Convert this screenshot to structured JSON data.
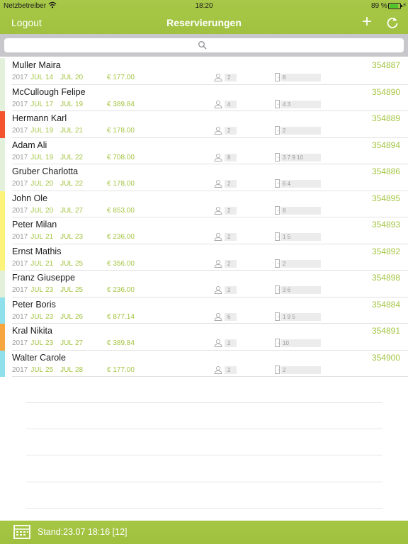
{
  "status": {
    "carrier": "Netzbetreiber",
    "time": "18:20",
    "battery": "89 %"
  },
  "nav": {
    "logout": "Logout",
    "title": "Reservierungen"
  },
  "search": {
    "placeholder": ""
  },
  "reservations": [
    {
      "name": "Muller Maira",
      "number": "354887",
      "year": "2017",
      "from_month": "JUL",
      "from_day": "14",
      "to_month": "JUL",
      "to_day": "20",
      "price": "€ 177.00",
      "guests": "2",
      "rooms": "8",
      "color": "#e3f0dc"
    },
    {
      "name": "McCullough Felipe",
      "number": "354890",
      "year": "2017",
      "from_month": "JUL",
      "from_day": "17",
      "to_month": "JUL",
      "to_day": "19",
      "price": "€ 389.84",
      "guests": "4",
      "rooms": "4 3",
      "color": "#e3f0dc"
    },
    {
      "name": "Hermann Karl",
      "number": "354889",
      "year": "2017",
      "from_month": "JUL",
      "from_day": "19",
      "to_month": "JUL",
      "to_day": "21",
      "price": "€ 178.00",
      "guests": "2",
      "rooms": "2",
      "color": "#f5532f"
    },
    {
      "name": "Adam Ali",
      "number": "354894",
      "year": "2017",
      "from_month": "JUL",
      "from_day": "19",
      "to_month": "JUL",
      "to_day": "22",
      "price": "€ 708.00",
      "guests": "8",
      "rooms": "3 7 9 10",
      "color": "#e3f0dc"
    },
    {
      "name": "Gruber Charlotta",
      "number": "354886",
      "year": "2017",
      "from_month": "JUL",
      "from_day": "20",
      "to_month": "JUL",
      "to_day": "22",
      "price": "€ 178.00",
      "guests": "2",
      "rooms": "6 4",
      "color": "#e3f0dc"
    },
    {
      "name": "John Ole",
      "number": "354895",
      "year": "2017",
      "from_month": "JUL",
      "from_day": "20",
      "to_month": "JUL",
      "to_day": "27",
      "price": "€ 853.00",
      "guests": "2",
      "rooms": "8",
      "color": "#fbf37a"
    },
    {
      "name": "Peter Milan",
      "number": "354893",
      "year": "2017",
      "from_month": "JUL",
      "from_day": "21",
      "to_month": "JUL",
      "to_day": "23",
      "price": "€ 236.00",
      "guests": "2",
      "rooms": "1 5",
      "color": "#fbf37a"
    },
    {
      "name": "Ernst Mathis",
      "number": "354892",
      "year": "2017",
      "from_month": "JUL",
      "from_day": "21",
      "to_month": "JUL",
      "to_day": "25",
      "price": "€ 356.00",
      "guests": "2",
      "rooms": "2",
      "color": "#fbf37a"
    },
    {
      "name": "Franz Giuseppe",
      "number": "354898",
      "year": "2017",
      "from_month": "JUL",
      "from_day": "23",
      "to_month": "JUL",
      "to_day": "25",
      "price": "€ 236.00",
      "guests": "2",
      "rooms": "3 6",
      "color": "#e3f0dc"
    },
    {
      "name": "Peter Boris",
      "number": "354884",
      "year": "2017",
      "from_month": "JUL",
      "from_day": "23",
      "to_month": "JUL",
      "to_day": "26",
      "price": "€ 877.14",
      "guests": "6",
      "rooms": "1 9 5",
      "color": "#8fe0ea"
    },
    {
      "name": "Kral Nikita",
      "number": "354891",
      "year": "2017",
      "from_month": "JUL",
      "from_day": "23",
      "to_month": "JUL",
      "to_day": "27",
      "price": "€ 389.84",
      "guests": "2",
      "rooms": "10",
      "color": "#f6a53f"
    },
    {
      "name": "Walter Carole",
      "number": "354900",
      "year": "2017",
      "from_month": "JUL",
      "from_day": "25",
      "to_month": "JUL",
      "to_day": "28",
      "price": "€ 177.00",
      "guests": "2",
      "rooms": "2",
      "color": "#8fe0ea"
    }
  ],
  "footer": {
    "stand": "Stand:23.07 18:16 [12]"
  },
  "colors": {
    "accent": "#a3c542",
    "accent_dark": "#9fbf3e"
  },
  "icons": {
    "add": "plus-icon",
    "refresh": "refresh-icon",
    "search": "search-icon",
    "guests": "person-icon",
    "rooms": "door-icon",
    "footer": "calendar-grid-icon"
  }
}
